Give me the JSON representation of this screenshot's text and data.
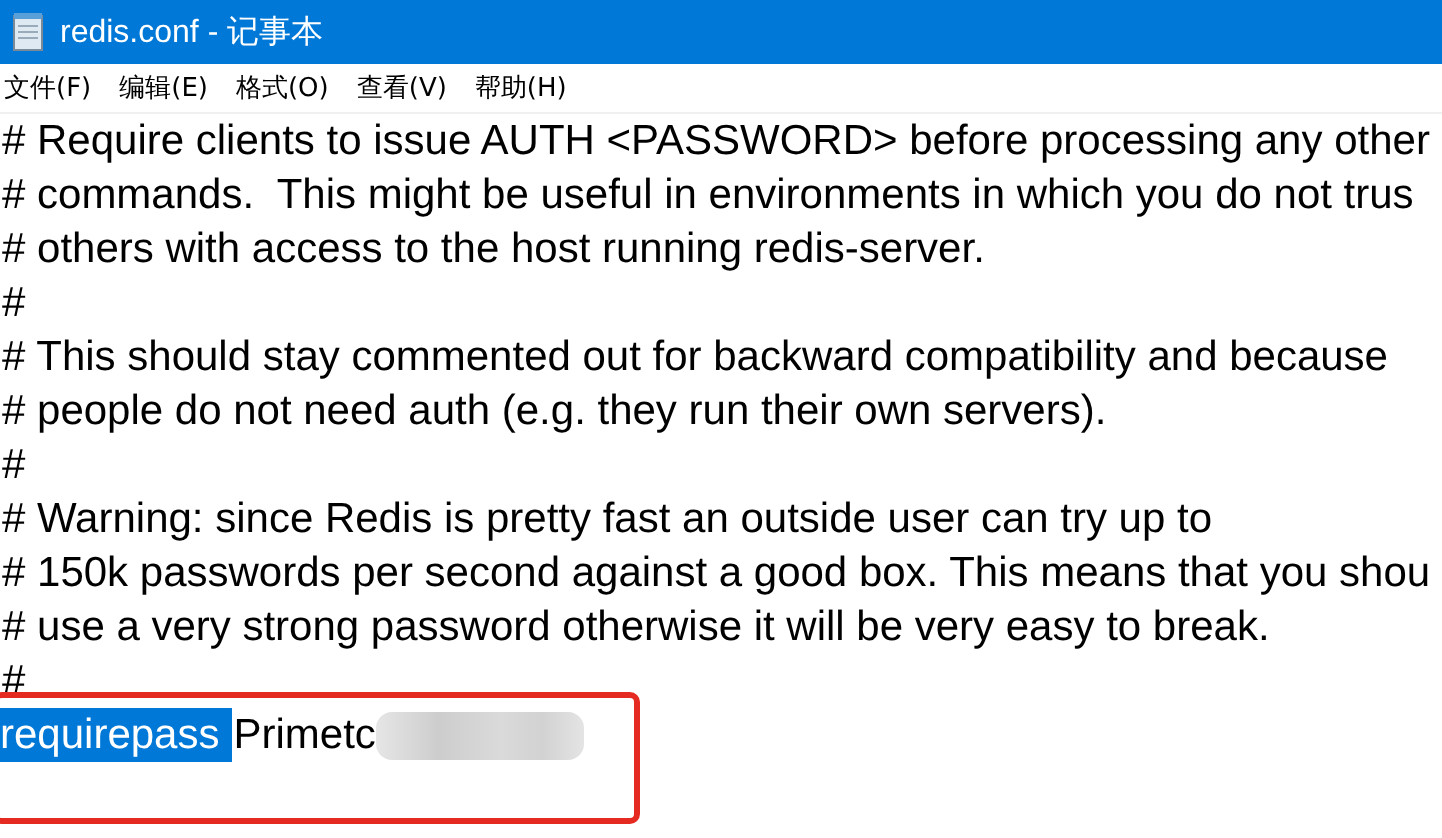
{
  "window": {
    "title": "redis.conf - 记事本"
  },
  "menu": [
    {
      "label": "文件(F)"
    },
    {
      "label": "编辑(E)"
    },
    {
      "label": "格式(O)"
    },
    {
      "label": "查看(V)"
    },
    {
      "label": "帮助(H)"
    }
  ],
  "lines": [
    {
      "kind": "text",
      "text": "# Require clients to issue AUTH <PASSWORD> before processing any other"
    },
    {
      "kind": "text",
      "text": "# commands.  This might be useful in environments in which you do not trus"
    },
    {
      "kind": "text",
      "text": "# others with access to the host running redis-server."
    },
    {
      "kind": "text",
      "text": "#"
    },
    {
      "kind": "text",
      "text": "# This should stay commented out for backward compatibility and because"
    },
    {
      "kind": "text",
      "text": "# people do not need auth (e.g. they run their own servers)."
    },
    {
      "kind": "text",
      "text": "#"
    },
    {
      "kind": "text",
      "text": "# Warning: since Redis is pretty fast an outside user can try up to"
    },
    {
      "kind": "text",
      "text": "# 150k passwords per second against a good box. This means that you shou"
    },
    {
      "kind": "text",
      "text": "# use a very strong password otherwise it will be very easy to break."
    },
    {
      "kind": "text",
      "text": "#"
    },
    {
      "kind": "setting",
      "selected_text": "requirepass",
      "text": "Primetc",
      "redacted": true,
      "annotated": true
    },
    {
      "kind": "blank"
    }
  ]
}
